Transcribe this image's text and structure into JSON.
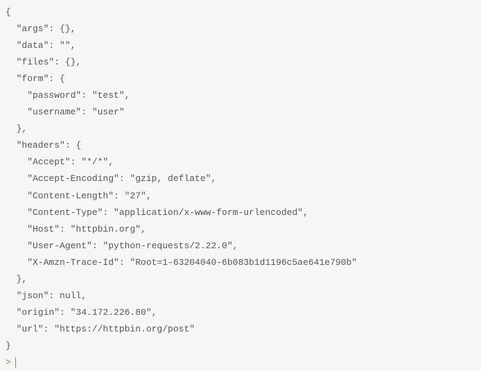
{
  "lines": [
    "{",
    "  \"args\": {}, ",
    "  \"data\": \"\", ",
    "  \"files\": {}, ",
    "  \"form\": {",
    "    \"password\": \"test\", ",
    "    \"username\": \"user\"",
    "  }, ",
    "  \"headers\": {",
    "    \"Accept\": \"*/*\", ",
    "    \"Accept-Encoding\": \"gzip, deflate\", ",
    "    \"Content-Length\": \"27\", ",
    "    \"Content-Type\": \"application/x-www-form-urlencoded\", ",
    "    \"Host\": \"httpbin.org\", ",
    "    \"User-Agent\": \"python-requests/2.22.0\", ",
    "    \"X-Amzn-Trace-Id\": \"Root=1-63204040-6b083b1d1196c5ae641e790b\"",
    "  }, ",
    "  \"json\": null, ",
    "  \"origin\": \"34.172.226.80\", ",
    "  \"url\": \"https://httpbin.org/post\"",
    "}"
  ],
  "prompt": ">"
}
